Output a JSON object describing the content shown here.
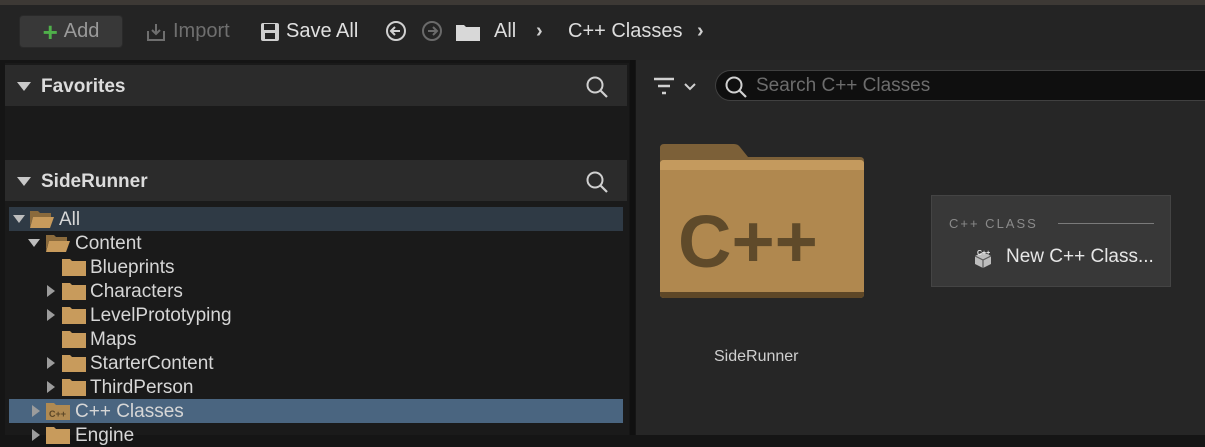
{
  "toolbar": {
    "add_label": "Add",
    "import_label": "Import",
    "save_all_label": "Save All",
    "breadcrumb": [
      "All",
      "C++ Classes"
    ]
  },
  "favorites": {
    "title": "Favorites"
  },
  "project": {
    "title": "SideRunner"
  },
  "tree": {
    "items": [
      "All",
      "Content",
      "Blueprints",
      "Characters",
      "LevelPrototyping",
      "Maps",
      "StarterContent",
      "ThirdPerson",
      "C++ Classes",
      "Engine"
    ]
  },
  "content": {
    "search_placeholder": "Search C++ Classes",
    "folder_tile": {
      "glyph": "C++",
      "label": "SideRunner"
    }
  },
  "context_menu": {
    "header": "C++ CLASS",
    "item": "New C++ Class..."
  },
  "colors": {
    "accent_green": "#4fb04a",
    "folder": "#b08a52",
    "selection": "#4a6580"
  }
}
